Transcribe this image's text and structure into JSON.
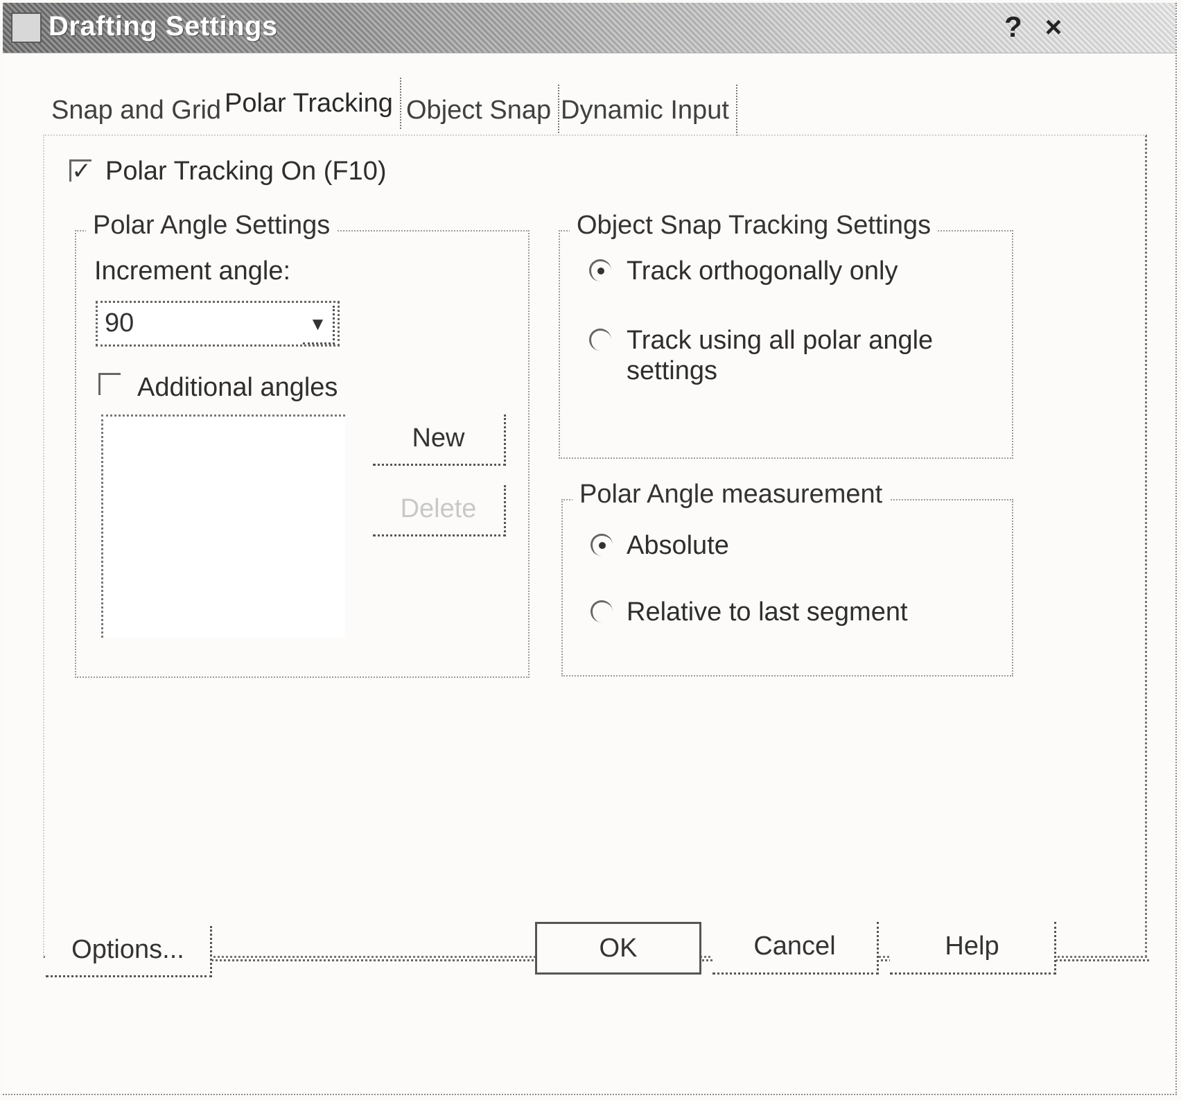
{
  "window": {
    "title": "Drafting Settings",
    "help_glyph": "?",
    "close_glyph": "×"
  },
  "tabs": [
    {
      "label": "Snap and Grid"
    },
    {
      "label": "Polar Tracking"
    },
    {
      "label": "Object Snap"
    },
    {
      "label": "Dynamic Input"
    }
  ],
  "polar_tracking_on": {
    "label": "Polar Tracking On (F10)",
    "checked": true,
    "check_glyph": "✓"
  },
  "polar_angle_settings": {
    "title": "Polar Angle Settings",
    "increment_label": "Increment angle:",
    "increment_value": "90",
    "dropdown_glyph": "▼",
    "additional_angles": {
      "label": "Additional angles",
      "checked": false
    },
    "new_button": "New",
    "delete_button": "Delete"
  },
  "object_snap_tracking": {
    "title": "Object Snap Tracking Settings",
    "options": [
      {
        "label": "Track orthogonally only",
        "selected": true
      },
      {
        "label_line1": "Track using all polar angle",
        "label_line2": "settings",
        "selected": false
      }
    ]
  },
  "polar_angle_measurement": {
    "title": "Polar Angle measurement",
    "options": [
      {
        "label": "Absolute",
        "selected": true
      },
      {
        "label": "Relative to last segment",
        "selected": false
      }
    ]
  },
  "footer": {
    "options_button": "Options...",
    "ok_button": "OK",
    "cancel_button": "Cancel",
    "help_button": "Help"
  }
}
